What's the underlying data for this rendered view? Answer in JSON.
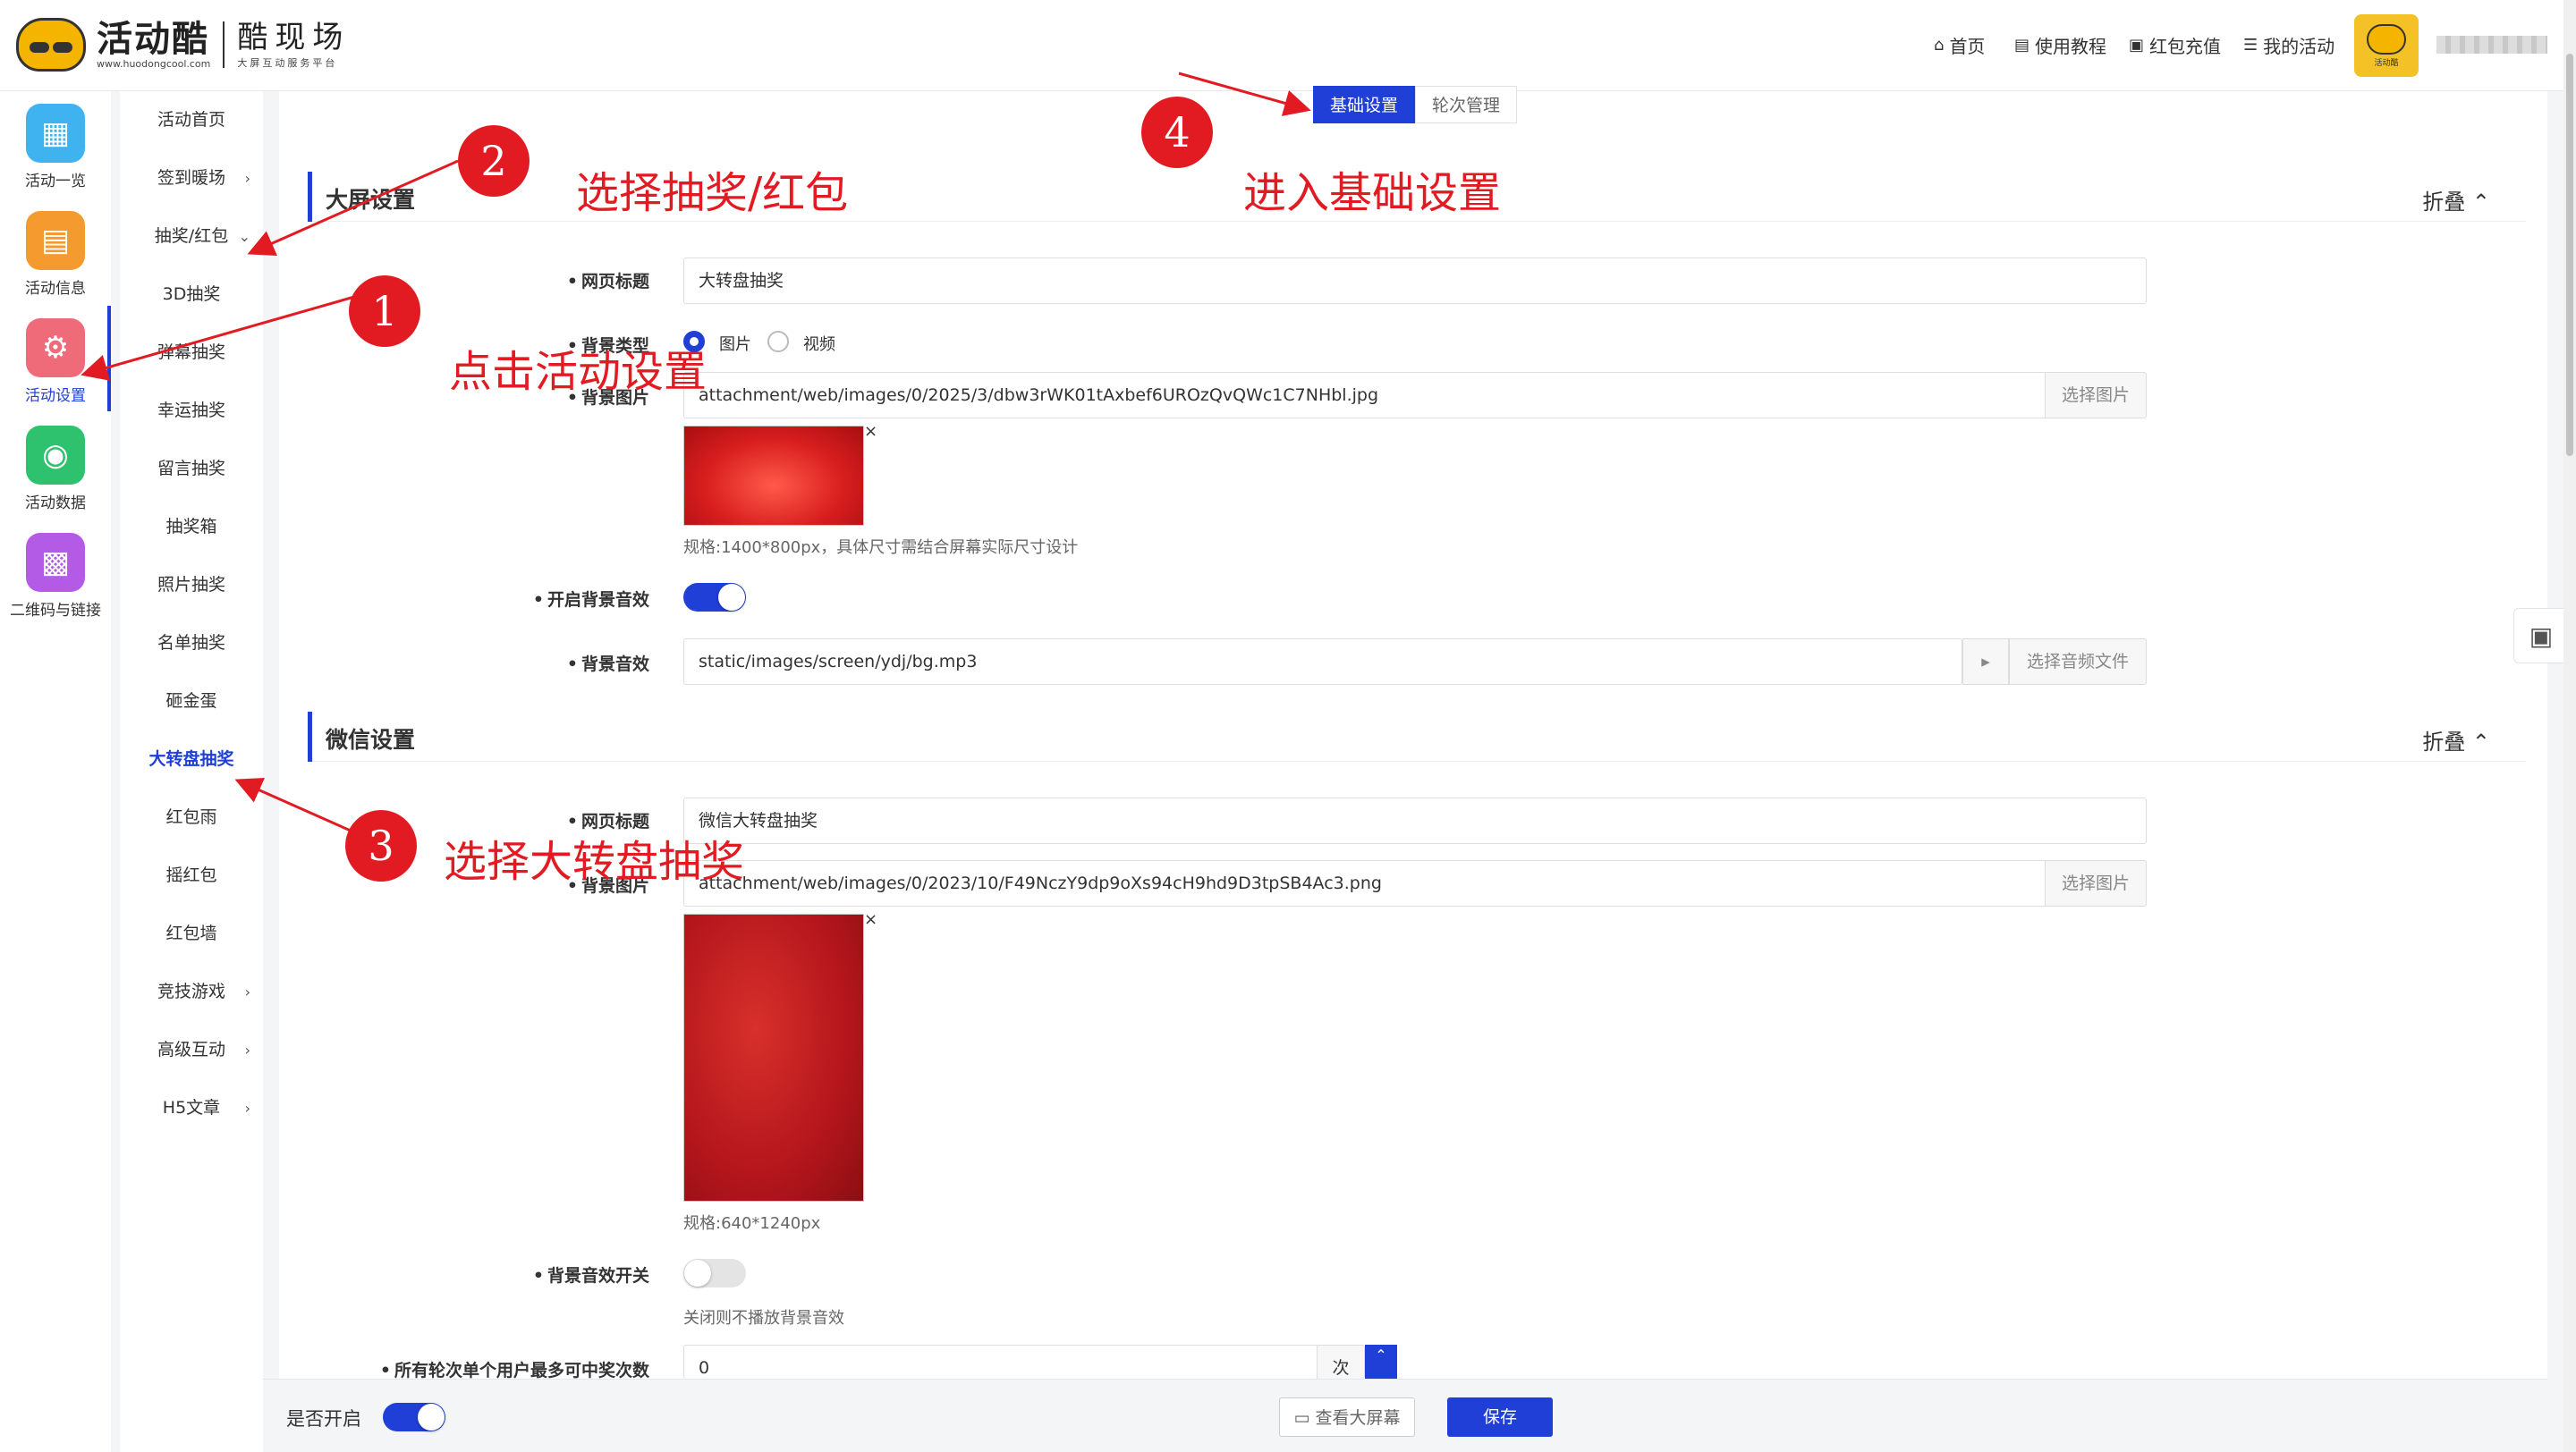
{
  "logo": {
    "brand": "活动酷",
    "domain": "www.huodongcool.com",
    "name": "酷现场",
    "tagline": "大屏互动服务平台"
  },
  "topnav": [
    {
      "icon": "home-icon",
      "label": "首页"
    },
    {
      "icon": "book-icon",
      "label": "使用教程"
    },
    {
      "icon": "wallet-icon",
      "label": "红包充值"
    },
    {
      "icon": "list-icon",
      "label": "我的活动"
    }
  ],
  "avatar_caption": "活动酷",
  "rail": [
    {
      "label": "活动一览",
      "color": "#3fb3f0",
      "glyph": "▦"
    },
    {
      "label": "活动信息",
      "color": "#f49a2e",
      "glyph": "▤"
    },
    {
      "label": "活动设置",
      "color": "#ef6b7a",
      "glyph": "⚙"
    },
    {
      "label": "活动数据",
      "color": "#2ec26e",
      "glyph": "◉"
    },
    {
      "label": "二维码与链接",
      "color": "#b35be6",
      "glyph": "▩"
    }
  ],
  "submenu": [
    {
      "label": "活动首页",
      "chev": ""
    },
    {
      "label": "签到暖场",
      "chev": "›"
    },
    {
      "label": "抽奖/红包",
      "chev": "⌄"
    },
    {
      "label": "3D抽奖",
      "chev": ""
    },
    {
      "label": "弹幕抽奖",
      "chev": ""
    },
    {
      "label": "幸运抽奖",
      "chev": ""
    },
    {
      "label": "留言抽奖",
      "chev": ""
    },
    {
      "label": "抽奖箱",
      "chev": ""
    },
    {
      "label": "照片抽奖",
      "chev": ""
    },
    {
      "label": "名单抽奖",
      "chev": ""
    },
    {
      "label": "砸金蛋",
      "chev": ""
    },
    {
      "label": "大转盘抽奖",
      "chev": ""
    },
    {
      "label": "红包雨",
      "chev": ""
    },
    {
      "label": "摇红包",
      "chev": ""
    },
    {
      "label": "红包墙",
      "chev": ""
    },
    {
      "label": "竞技游戏",
      "chev": "›"
    },
    {
      "label": "高级互动",
      "chev": "›"
    },
    {
      "label": "H5文章",
      "chev": "›"
    }
  ],
  "tabs": [
    "基础设置",
    "轮次管理"
  ],
  "screen_section": {
    "title": "大屏设置",
    "fold": "折叠 ⌃",
    "page_title_label": "网页标题",
    "page_title_value": "大转盘抽奖",
    "bg_type_label": "背景类型",
    "bg_type_options": [
      "图片",
      "视频"
    ],
    "bg_image_label": "背景图片",
    "bg_image_value": "attachment/web/images/0/2025/3/dbw3rWK01tAxbef6UROzQvQWc1C7NHbl.jpg",
    "choose_image": "选择图片",
    "bg_image_hint": "规格:1400*800px，具体尺寸需结合屏幕实际尺寸设计",
    "bg_music_switch_label": "开启背景音效",
    "bg_music_label": "背景音效",
    "bg_music_value": "static/images/screen/ydj/bg.mp3",
    "choose_audio": "选择音频文件"
  },
  "wechat_section": {
    "title": "微信设置",
    "fold": "折叠 ⌃",
    "page_title_label": "网页标题",
    "page_title_value": "微信大转盘抽奖",
    "bg_image_label": "背景图片",
    "bg_image_value": "attachment/web/images/0/2023/10/F49NczY9dp9oXs94cH9hd9D3tpSB4Ac3.png",
    "choose_image": "选择图片",
    "bg_image_hint": "规格:640*1240px",
    "bg_music_switch_label": "背景音效开关",
    "bg_music_hint": "关闭则不播放背景音效",
    "max_win_label": "所有轮次单个用户最多可中奖次数",
    "max_win_value": "0",
    "max_win_unit": "次"
  },
  "bottom": {
    "enabled_label": "是否开启",
    "view_screen": "查看大屏幕",
    "save": "保存"
  },
  "annotations": [
    {
      "num": "1",
      "text": "点击活动设置"
    },
    {
      "num": "2",
      "text": "选择抽奖/红包"
    },
    {
      "num": "3",
      "text": "选择大转盘抽奖"
    },
    {
      "num": "4",
      "text": "进入基础设置"
    }
  ],
  "colors": {
    "accent": "#1f3fd6",
    "annotation": "#e21b23"
  }
}
